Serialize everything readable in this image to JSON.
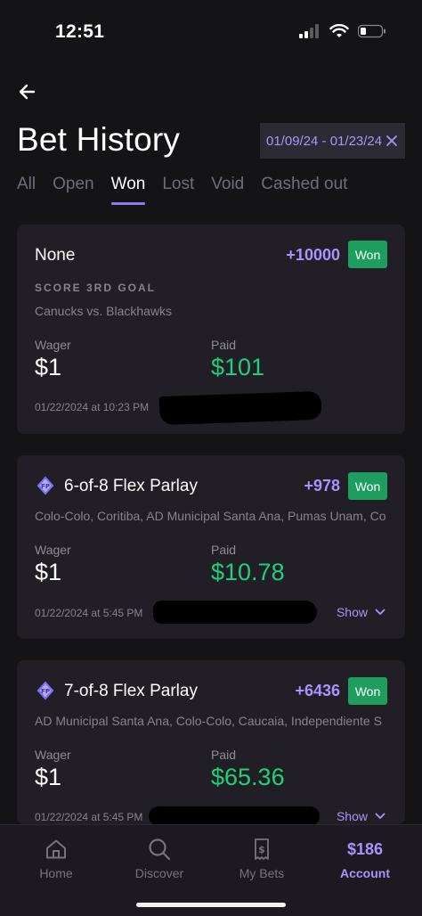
{
  "status": {
    "time": "12:51"
  },
  "header": {
    "title": "Bet History",
    "date_range": "01/09/24 - 01/23/24"
  },
  "tabs": [
    {
      "label": "All"
    },
    {
      "label": "Open"
    },
    {
      "label": "Won"
    },
    {
      "label": "Lost"
    },
    {
      "label": "Void"
    },
    {
      "label": "Cashed out"
    }
  ],
  "active_tab": "Won",
  "bets": [
    {
      "title": "None",
      "odds": "+10000",
      "status": "Won",
      "market": "SCORE 3RD GOAL",
      "matchup": "Canucks vs. Blackhawks",
      "wager_label": "Wager",
      "wager": "$1",
      "paid_label": "Paid",
      "paid": "$101",
      "timestamp": "01/22/2024 at 10:23 PM"
    },
    {
      "title": "6-of-8 Flex Parlay",
      "odds": "+978",
      "status": "Won",
      "matchup": "Colo-Colo, Coritiba, AD Municipal Santa Ana, Pumas Unam, Co",
      "wager_label": "Wager",
      "wager": "$1",
      "paid_label": "Paid",
      "paid": "$10.78",
      "timestamp": "01/22/2024 at 5:45 PM",
      "show_label": "Show"
    },
    {
      "title": "7-of-8 Flex Parlay",
      "odds": "+6436",
      "status": "Won",
      "matchup": "AD Municipal Santa Ana, Colo-Colo, Caucaia, Independiente S",
      "wager_label": "Wager",
      "wager": "$1",
      "paid_label": "Paid",
      "paid": "$65.36",
      "timestamp": "01/22/2024 at 5:45 PM",
      "show_label": "Show"
    }
  ],
  "nav": {
    "home": "Home",
    "discover": "Discover",
    "my_bets": "My Bets",
    "balance": "$186",
    "account": "Account"
  },
  "colors": {
    "accent": "#8d78f2",
    "won": "#1e9e5e",
    "paid": "#1fcf79",
    "background": "#141316",
    "card": "#211f25"
  }
}
